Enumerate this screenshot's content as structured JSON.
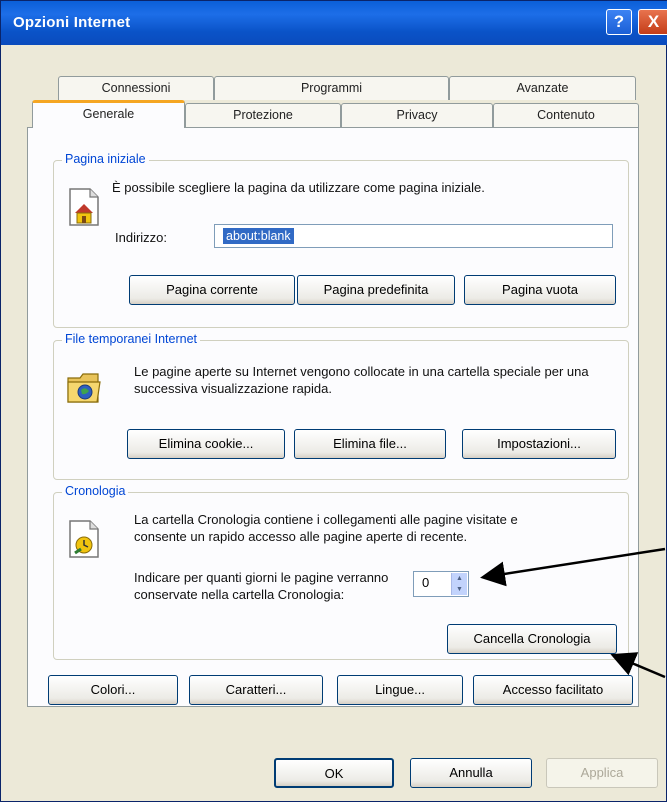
{
  "window": {
    "title": "Opzioni Internet",
    "help_label": "?",
    "close_label": "X"
  },
  "tabs": {
    "row1": [
      "Connessioni",
      "Programmi",
      "Avanzate"
    ],
    "row2": [
      "Generale",
      "Protezione",
      "Privacy",
      "Contenuto"
    ],
    "active": "Generale"
  },
  "home_page": {
    "legend": "Pagina iniziale",
    "description": "È possibile scegliere la pagina da utilizzare come pagina iniziale.",
    "address_label": "Indirizzo:",
    "address_value": "about:blank",
    "buttons": [
      "Pagina corrente",
      "Pagina predefinita",
      "Pagina vuota"
    ],
    "icon": "house-page-icon"
  },
  "temp_files": {
    "legend": "File temporanei Internet",
    "description": "Le pagine aperte su Internet vengono collocate in una cartella speciale per una successiva visualizzazione rapida.",
    "buttons": [
      "Elimina cookie...",
      "Elimina file...",
      "Impostazioni..."
    ],
    "icon": "folder-globe-icon"
  },
  "history": {
    "legend": "Cronologia",
    "description": "La cartella Cronologia contiene i collegamenti alle pagine visitate e consente un rapido accesso alle pagine aperte di recente.",
    "days_label": "Indicare per quanti giorni le pagine verranno conservate nella cartella Cronologia:",
    "days_value": "0",
    "clear_button": "Cancella Cronologia",
    "icon": "history-page-icon"
  },
  "bottom_buttons": [
    "Colori...",
    "Caratteri...",
    "Lingue...",
    "Accesso facilitato"
  ],
  "dialog_buttons": {
    "ok": "OK",
    "cancel": "Annulla",
    "apply": "Applica"
  },
  "colors": {
    "titlebar": "#0a53c8",
    "legend_text": "#0046d5",
    "selection": "#316ac5",
    "tab_highlight": "#f5a623"
  }
}
